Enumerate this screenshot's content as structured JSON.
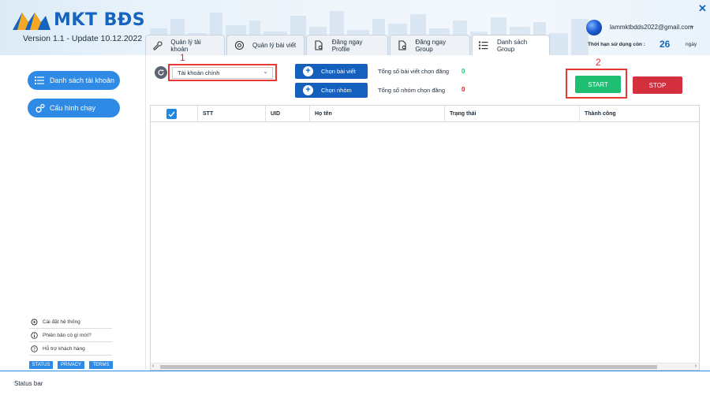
{
  "app": {
    "logo_text": "MKT BĐS",
    "version": "Version 1.1 - Update 10.12.2022",
    "close_icon": "close-icon"
  },
  "tabs": [
    {
      "label": "Quản lý tài khoản",
      "icon": "wrench-icon"
    },
    {
      "label": "Quản lý bài viết",
      "icon": "gear-refresh-icon"
    },
    {
      "label": "Đăng ngay Profile",
      "icon": "document-gear-icon"
    },
    {
      "label": "Đăng ngay Group",
      "icon": "document-gear-icon"
    },
    {
      "label": "Danh sách Group",
      "icon": "list-icon"
    }
  ],
  "account": {
    "email": "lammktbdds2022@gmail.com",
    "expire_label": "Thời hạn sử dụng còn :",
    "expire_days": "26",
    "expire_unit": "ngày"
  },
  "sidebar": {
    "buttons": [
      {
        "label": "Danh sách tài khoản",
        "icon": "list-icon"
      },
      {
        "label": "Cấu hình chạy",
        "icon": "gears-icon"
      }
    ],
    "links": [
      {
        "label": "Cài đặt hệ thống",
        "icon": "gear-icon"
      },
      {
        "label": "Phiên bản có gì mới?",
        "icon": "info-icon"
      },
      {
        "label": "Hỗ trợ khách hàng",
        "icon": "help-icon"
      }
    ],
    "badges": [
      "STATUS",
      "PRIVACY",
      "TERMS"
    ]
  },
  "controls": {
    "account_select_value": "Tài khoản chính",
    "annotation_1": "1",
    "annotation_2": "2",
    "choose_post_label": "Chọn bài viết",
    "choose_group_label": "Chọn nhóm",
    "total_posts_label": "Tổng số bài viết chọn đăng",
    "total_posts_value": "0",
    "total_groups_label": "Tổng số nhóm chọn đăng",
    "total_groups_value": "0",
    "start_label": "START",
    "stop_label": "STOP",
    "colors": {
      "start": "#1fbf73",
      "stop": "#d32f3f",
      "count_green": "#1fbf73",
      "count_red": "#c62828"
    }
  },
  "table": {
    "columns": [
      "STT",
      "UID",
      "Họ tên",
      "Trạng thái",
      "Thành công"
    ],
    "rows": []
  },
  "status_bar": {
    "text": "Status bar"
  }
}
